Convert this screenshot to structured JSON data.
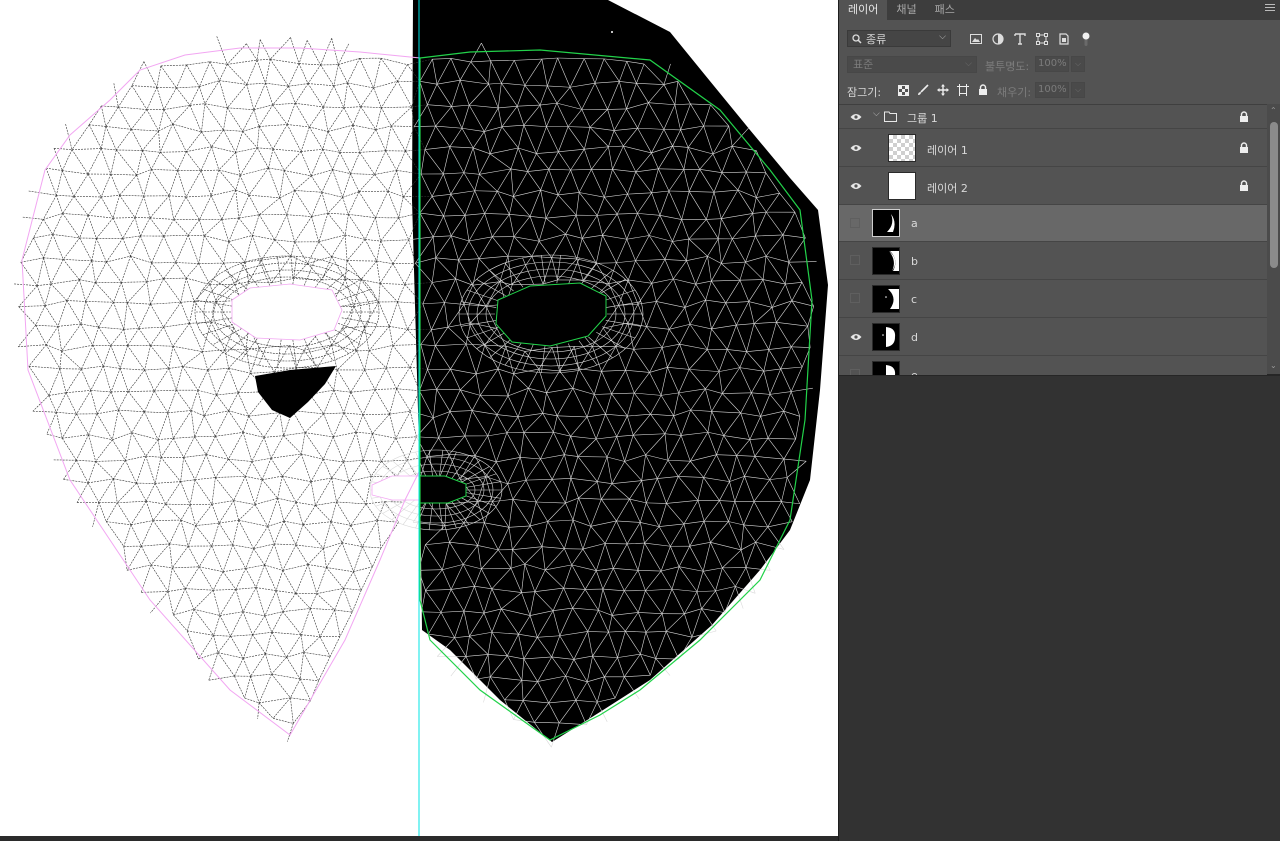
{
  "layers_panel": {
    "tabs": [
      {
        "label": "레이어",
        "active": true
      },
      {
        "label": "채널",
        "active": false
      },
      {
        "label": "패스",
        "active": false
      }
    ],
    "filter": {
      "label": "종류",
      "icon": "search-icon"
    },
    "filter_icons": [
      "image-filter-icon",
      "adjustment-filter-icon",
      "type-filter-icon",
      "shape-filter-icon",
      "smart-object-filter-icon",
      "filter-toggle-icon"
    ],
    "blend_mode": "표준",
    "opacity_label": "불투명도:",
    "opacity_value": "100%",
    "lock_label": "잠그기:",
    "lock_icons": [
      "lock-transparent-pixels-icon",
      "lock-image-pixels-icon",
      "lock-position-icon",
      "lock-artboard-icon",
      "lock-all-icon"
    ],
    "fill_label": "채우기:",
    "fill_value": "100%",
    "layers": [
      {
        "name": "그룹 1",
        "type": "group",
        "visible": true,
        "locked": true,
        "selected": false
      },
      {
        "name": "레이어 1",
        "type": "transparent",
        "visible": true,
        "locked": true,
        "selected": false
      },
      {
        "name": "레이어 2",
        "type": "white",
        "visible": true,
        "locked": true,
        "selected": false
      },
      {
        "name": "a",
        "type": "mask",
        "visible": false,
        "locked": false,
        "selected": true
      },
      {
        "name": "b",
        "type": "mask",
        "visible": false,
        "locked": false,
        "selected": false
      },
      {
        "name": "c",
        "type": "mask",
        "visible": false,
        "locked": false,
        "selected": false
      },
      {
        "name": "d",
        "type": "mask",
        "visible": true,
        "locked": false,
        "selected": false
      },
      {
        "name": "e",
        "type": "mask",
        "visible": false,
        "locked": false,
        "selected": false
      }
    ]
  },
  "colors": {
    "canvas_bg": "#ffffff",
    "guide": "#00e5e5",
    "left_outline": "#f2a6f2",
    "right_outline": "#22d24a",
    "panel_bg": "#535353",
    "workspace_bg": "#323232",
    "selected_row": "#686868"
  }
}
